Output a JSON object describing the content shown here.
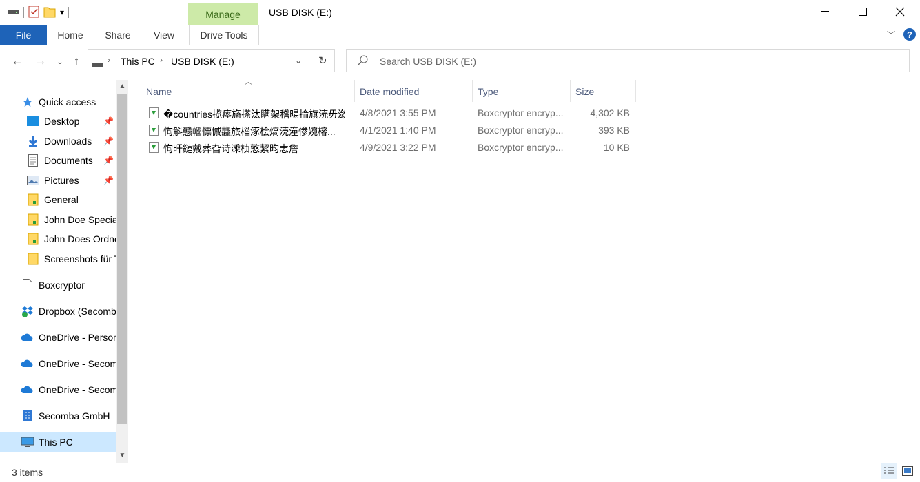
{
  "window": {
    "title": "USB DISK (E:)",
    "manage_label": "Manage",
    "controls": [
      "minimize",
      "maximize",
      "close"
    ]
  },
  "ribbon": {
    "tabs": [
      {
        "label": "File"
      },
      {
        "label": "Home"
      },
      {
        "label": "Share"
      },
      {
        "label": "View"
      },
      {
        "label": "Drive Tools"
      }
    ]
  },
  "address": {
    "crumbs": [
      "This PC",
      "USB DISK (E:)"
    ]
  },
  "search": {
    "placeholder": "Search USB DISK (E:)"
  },
  "sidebar": {
    "items": [
      {
        "label": "Quick access",
        "icon": "star-icon"
      },
      {
        "label": "Desktop",
        "icon": "desktop-icon",
        "pinned": true
      },
      {
        "label": "Downloads",
        "icon": "download-icon",
        "pinned": true
      },
      {
        "label": "Documents",
        "icon": "document-icon",
        "pinned": true
      },
      {
        "label": "Pictures",
        "icon": "pictures-icon",
        "pinned": true
      },
      {
        "label": "General",
        "icon": "folder-icon"
      },
      {
        "label": "John Doe Specia",
        "icon": "folder-icon"
      },
      {
        "label": "John Does Ordne",
        "icon": "folder-icon"
      },
      {
        "label": "Screenshots für T",
        "icon": "folder-icon"
      },
      {
        "label": "Boxcryptor",
        "icon": "file-icon"
      },
      {
        "label": "Dropbox (Secomb",
        "icon": "dropbox-icon"
      },
      {
        "label": "OneDrive - Person",
        "icon": "cloud-icon"
      },
      {
        "label": "OneDrive - Secom",
        "icon": "cloud-icon"
      },
      {
        "label": "OneDrive - Secom",
        "icon": "cloud-icon"
      },
      {
        "label": "Secomba GmbH",
        "icon": "building-icon"
      },
      {
        "label": "This PC",
        "icon": "computer-icon",
        "selected": true
      }
    ]
  },
  "file_list": {
    "columns": [
      "Name",
      "Date modified",
      "Type",
      "Size"
    ],
    "rows": [
      {
        "name": "�countries揽瘗旖搽汰瞒架稽暘掄旗涜毋潋楄楝窒",
        "date": "4/8/2021 3:55 PM",
        "type": "Boxcryptor encryp...",
        "size": "4,302 KB"
      },
      {
        "name": "恂斛戆幗慓慽龘旅椔涿桧熇涜潼惨婉榕...",
        "date": "4/1/2021 1:40 PM",
        "type": "Boxcryptor encryp...",
        "size": "393 KB"
      },
      {
        "name": "恂旰鏈戴葬旮诗溗桢憼絜昀恚詹",
        "date": "4/9/2021 3:22 PM",
        "type": "Boxcryptor encryp...",
        "size": "10 KB"
      }
    ]
  },
  "status": {
    "item_count": "3 items"
  },
  "colors": {
    "file_tab": "#1e63b8",
    "manage_bg": "#cdeaa8",
    "selected": "#cce8ff",
    "column_header": "#4d5b7c"
  }
}
